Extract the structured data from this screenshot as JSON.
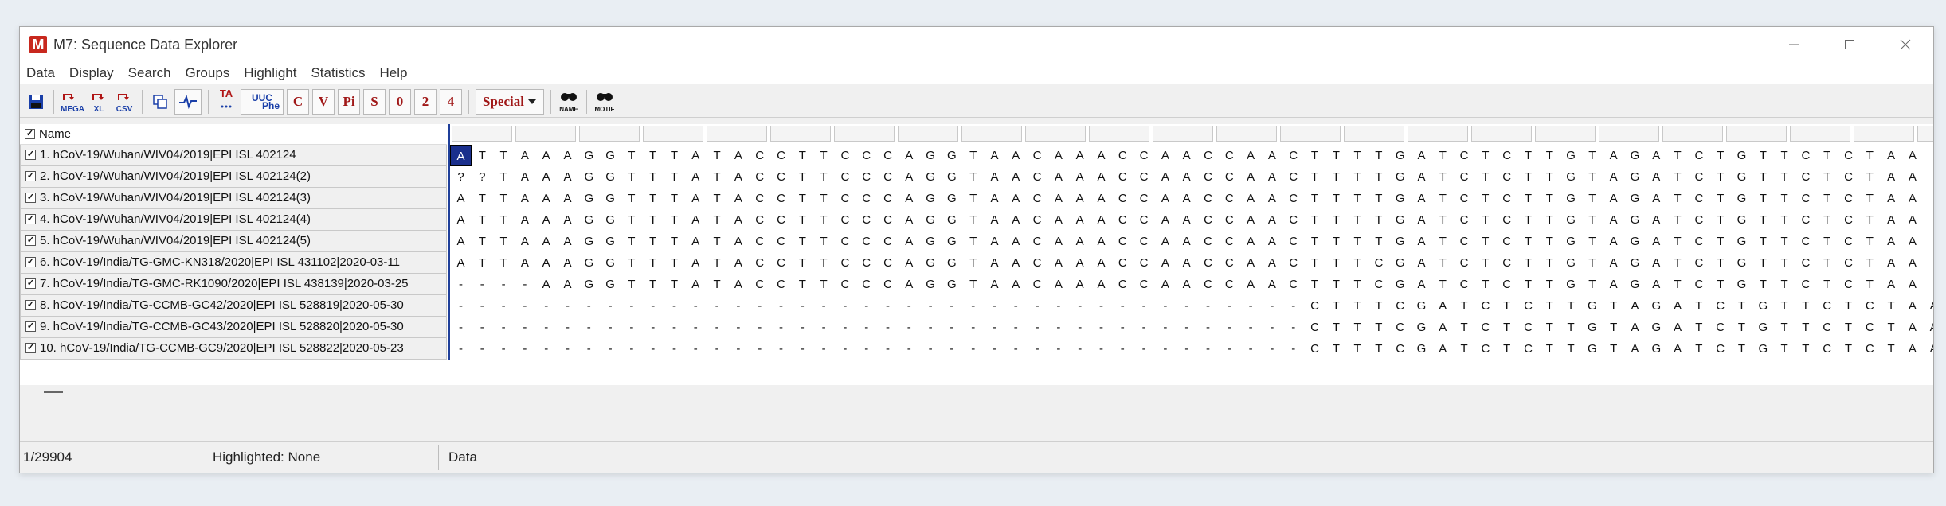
{
  "window": {
    "title": "M7: Sequence Data Explorer",
    "app_icon_letter": "M"
  },
  "menu": [
    "Data",
    "Display",
    "Search",
    "Groups",
    "Highlight",
    "Statistics",
    "Help"
  ],
  "toolbar": {
    "mega_label": "MEGA",
    "xl_label": "XL",
    "csv_label": "CSV",
    "ta_label": "TA",
    "uuc_label": "UUC",
    "phe_label": "Phe",
    "c_label": "C",
    "v_label": "V",
    "pi_label": "Pi",
    "s_label": "S",
    "zero_label": "0",
    "two_label": "2",
    "four_label": "4",
    "special_label": "Special",
    "name_label": "NAME",
    "motif_label": "MOTIF"
  },
  "grid": {
    "header": "Name",
    "rows": [
      "1. hCoV-19/Wuhan/WIV04/2019|EPI ISL 402124",
      "2. hCoV-19/Wuhan/WIV04/2019|EPI ISL 402124(2)",
      "3. hCoV-19/Wuhan/WIV04/2019|EPI ISL 402124(3)",
      "4. hCoV-19/Wuhan/WIV04/2019|EPI ISL 402124(4)",
      "5. hCoV-19/Wuhan/WIV04/2019|EPI ISL 402124(5)",
      "6. hCoV-19/India/TG-GMC-KN318/2020|EPI ISL 431102|2020-03-11",
      "7. hCoV-19/India/TG-GMC-RK1090/2020|EPI ISL 438139|2020-03-25",
      "8. hCoV-19/India/TG-CCMB-GC42/2020|EPI ISL 528819|2020-05-30",
      "9. hCoV-19/India/TG-CCMB-GC43/2020|EPI ISL 528820|2020-05-30",
      "10. hCoV-19/India/TG-CCMB-GC9/2020|EPI ISL 528822|2020-05-23"
    ],
    "sequences": [
      "ATTAAAGGTTTATACCTTCCCAGGTAACAAACCAACCAACTTTTGATCTCTTGTAGATCTGTTCTCTAA",
      "??TAAAGGTTTATACCTTCCCAGGTAACAAACCAACCAACTTTTGATCTCTTGTAGATCTGTTCTCTAA",
      "ATTAAAGGTTTATACCTTCCCAGGTAACAAACCAACCAACTTTTGATCTCTTGTAGATCTGTTCTCTAA",
      "ATTAAAGGTTTATACCTTCCCAGGTAACAAACCAACCAACTTTTGATCTCTTGTAGATCTGTTCTCTAA",
      "ATTAAAGGTTTATACCTTCCCAGGTAACAAACCAACCAACTTTTGATCTCTTGTAGATCTGTTCTCTAA",
      "ATTAAAGGTTTATACCTTCCCAGGTAACAAACCAACCAACTTTCGATCTCTTGTAGATCTGTTCTCTAA",
      "----AAGGTTTATACCTTCCCAGGTAACAAACCAACCAACTTTCGATCTCTTGTAGATCTGTTCTCTAA",
      "----------------------------------------CTTTCGATCTCTTGTAGATCTGTTCTCTAA",
      "----------------------------------------CTTTCGATCTCTTGTAGATCTGTTCTCTAA",
      "----------------------------------------CTTTCGATCTCTTGTAGATCTGTTCTCTAA"
    ]
  },
  "status": {
    "position": "1/29904",
    "highlighted": "Highlighted: None",
    "mode": "Data"
  }
}
